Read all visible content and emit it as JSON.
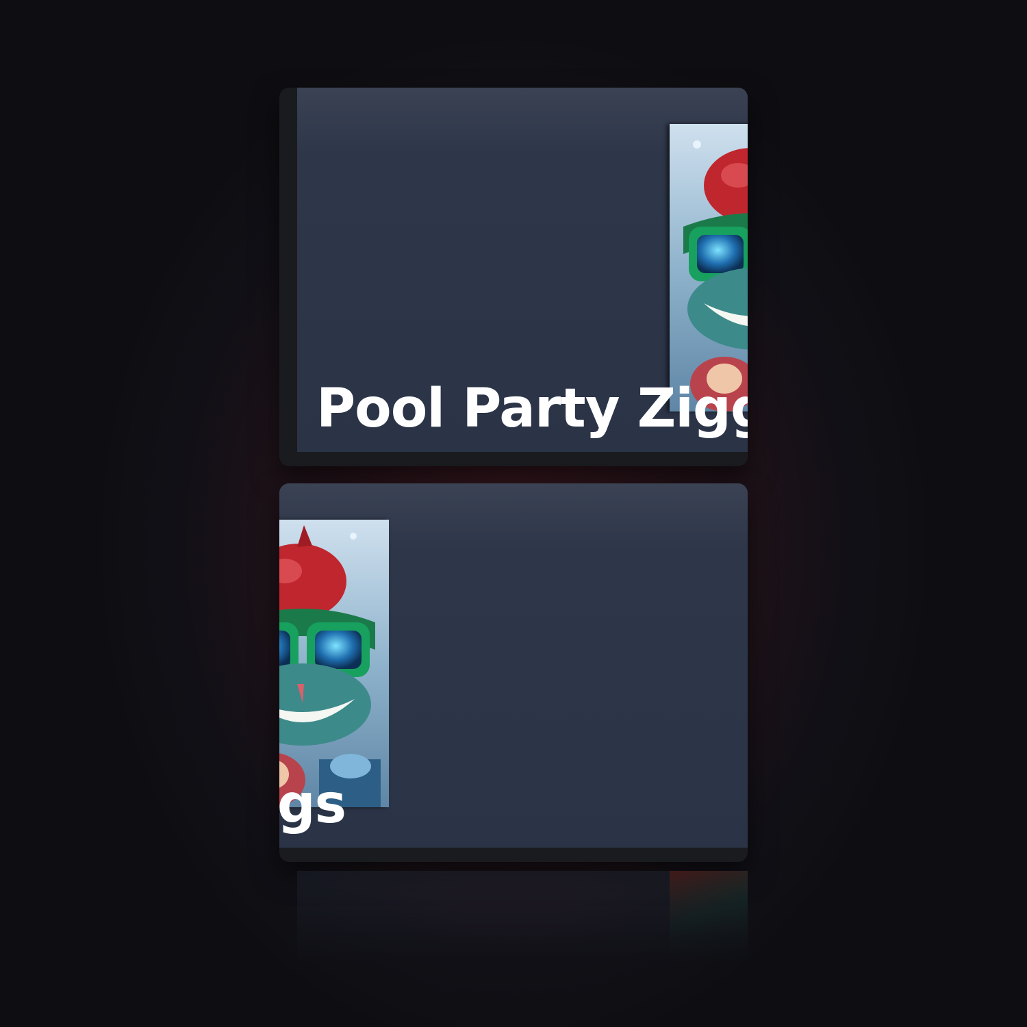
{
  "banner": {
    "title": "Pool Party Ziggs",
    "art_icon": "splash-art-pool-party-ziggs"
  },
  "colors": {
    "banner_bg": "#2b3447",
    "card_frame": "#1a1b1f",
    "title_text": "#ffffff",
    "backdrop_glow": "#3a1820"
  }
}
